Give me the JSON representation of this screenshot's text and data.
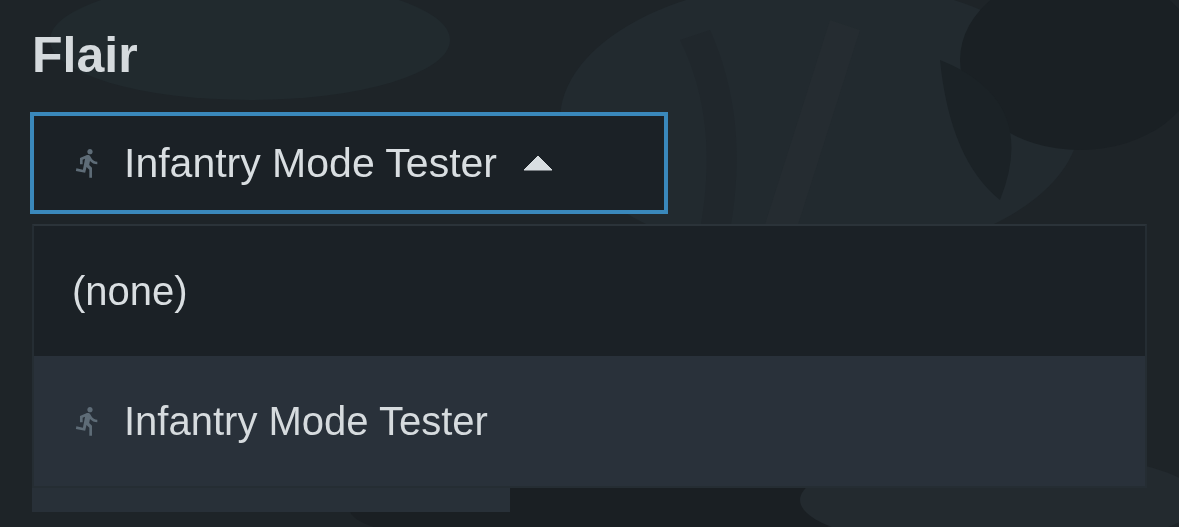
{
  "section": {
    "title": "Flair"
  },
  "dropdown": {
    "value": "Infantry Mode Tester",
    "icon": true,
    "expanded": true,
    "options": [
      {
        "label": "(none)",
        "icon": false,
        "selected": false
      },
      {
        "label": "Infantry Mode Tester",
        "icon": true,
        "selected": true
      }
    ]
  }
}
